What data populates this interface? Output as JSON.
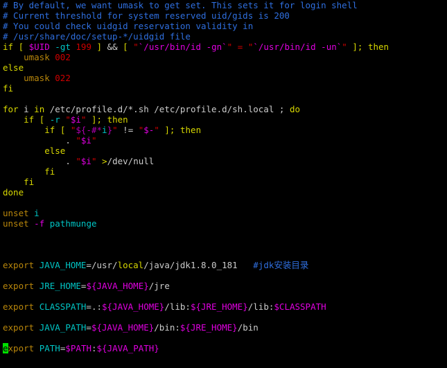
{
  "terminal": {
    "title": "Terminal — /etc/profile",
    "background_color": "#000000",
    "cursor_color": "#00e000",
    "cursor_row": 34,
    "cursor_col": 1,
    "palette": {
      "comment": "#2f6fdf",
      "keyword": "#d7d700",
      "statement": "#b8860b",
      "variable": "#e000e0",
      "string": "#cf0000",
      "number": "#cf0000",
      "option": "#00c5c5",
      "identifier": "#00c5c5",
      "plain": "#cccccc"
    }
  },
  "lines": {
    "l1": {
      "t1": "# By default, we want umask to get set. This sets it for login shell"
    },
    "l2": {
      "t1": "# Current threshold for system reserved uid/gids is 200"
    },
    "l3": {
      "t1": "# You could check uidgid reservation validity in"
    },
    "l4": {
      "t1": "# /usr/share/doc/setup-*/uidgid file"
    },
    "l5": {
      "t1": "if",
      "t2": " ",
      "t3": "[",
      "t4": " ",
      "t5": "$UID",
      "t6": " ",
      "t7": "-gt",
      "t8": " ",
      "t9": "199",
      "t10": " ",
      "t11": "]",
      "t12": " ",
      "t13": "&&",
      "t14": " ",
      "t15": "[",
      "t16": " ",
      "t17": "\"",
      "t18": "`/usr/bin/id -gn`",
      "t19": "\"",
      "t20": " = ",
      "t21": "\"",
      "t22": "`/usr/bin/id -un`",
      "t23": "\"",
      "t24": " ",
      "t25": "];",
      "t26": " ",
      "t27": "then"
    },
    "l6": {
      "t1": "    ",
      "t2": "umask",
      "t3": " ",
      "t4": "002"
    },
    "l7": {
      "t1": "else"
    },
    "l8": {
      "t1": "    ",
      "t2": "umask",
      "t3": " ",
      "t4": "022"
    },
    "l9": {
      "t1": "fi"
    },
    "l10": {
      "t1": ""
    },
    "l11": {
      "t1": "for",
      "t2": " ",
      "t3": "i",
      "t4": " ",
      "t5": "in",
      "t6": " /etc/profile.d/*.sh /etc/profile.d/sh.local ",
      "t7": ";",
      "t8": " ",
      "t9": "do"
    },
    "l12": {
      "t1": "    ",
      "t2": "if",
      "t3": " ",
      "t4": "[",
      "t5": " ",
      "t6": "-r",
      "t7": " ",
      "t8": "\"",
      "t9": "$i",
      "t10": "\"",
      "t11": " ",
      "t12": "];",
      "t13": " ",
      "t14": "then"
    },
    "l13": {
      "t1": "        ",
      "t2": "if",
      "t3": " ",
      "t4": "[",
      "t5": " ",
      "t6": "\"",
      "t7": "${-#*",
      "t8": "i",
      "t9": "}",
      "t10": "\"",
      "t11": " != ",
      "t12": "\"",
      "t13": "$-",
      "t14": "\"",
      "t15": " ",
      "t16": "];",
      "t17": " ",
      "t18": "then"
    },
    "l14": {
      "t1": "            ",
      "t2": ".",
      "t3": " ",
      "t4": "\"",
      "t5": "$i",
      "t6": "\""
    },
    "l15": {
      "t1": "        ",
      "t2": "else"
    },
    "l16": {
      "t1": "            ",
      "t2": ".",
      "t3": " ",
      "t4": "\"",
      "t5": "$i",
      "t6": "\"",
      "t7": " ",
      "t8": ">",
      "t9": "/dev/null"
    },
    "l17": {
      "t1": "        ",
      "t2": "fi"
    },
    "l18": {
      "t1": "    ",
      "t2": "fi"
    },
    "l19": {
      "t1": "done"
    },
    "l20": {
      "t1": ""
    },
    "l21": {
      "t1": "unset",
      "t2": " ",
      "t3": "i"
    },
    "l22": {
      "t1": "unset",
      "t2": " ",
      "t3": "-f",
      "t4": " ",
      "t5": "pathmunge"
    },
    "l23": {
      "t1": ""
    },
    "l24": {
      "t1": ""
    },
    "l25": {
      "t1": ""
    },
    "l26": {
      "t1": "export",
      "t2": " ",
      "t3": "JAVA_HOME",
      "t4": "=/usr/",
      "t5": "local",
      "t6": "/java/jdk1.8.0_181",
      "t7": "   ",
      "t8": "#jdk安装目录"
    },
    "l27": {
      "t1": ""
    },
    "l28": {
      "t1": "export",
      "t2": " ",
      "t3": "JRE_HOME",
      "t4": "=",
      "t5": "${JAVA_HOME}",
      "t6": "/jre"
    },
    "l29": {
      "t1": ""
    },
    "l30": {
      "t1": "export",
      "t2": " ",
      "t3": "CLASSPATH",
      "t4": "=.:",
      "t5": "${JAVA_HOME}",
      "t6": "/lib:",
      "t7": "${JRE_HOME}",
      "t8": "/lib:",
      "t9": "$CLASSPATH"
    },
    "l31": {
      "t1": ""
    },
    "l32": {
      "t1": "export",
      "t2": " ",
      "t3": "JAVA_PATH",
      "t4": "=",
      "t5": "${JAVA_HOME}",
      "t6": "/bin:",
      "t7": "${JRE_HOME}",
      "t8": "/bin"
    },
    "l33": {
      "t1": ""
    },
    "l34": {
      "t1": "e",
      "t2": "xport",
      "t3": " ",
      "t4": "PATH",
      "t5": "=",
      "t6": "$PATH",
      "t7": ":",
      "t8": "${JAVA_PATH}"
    }
  }
}
